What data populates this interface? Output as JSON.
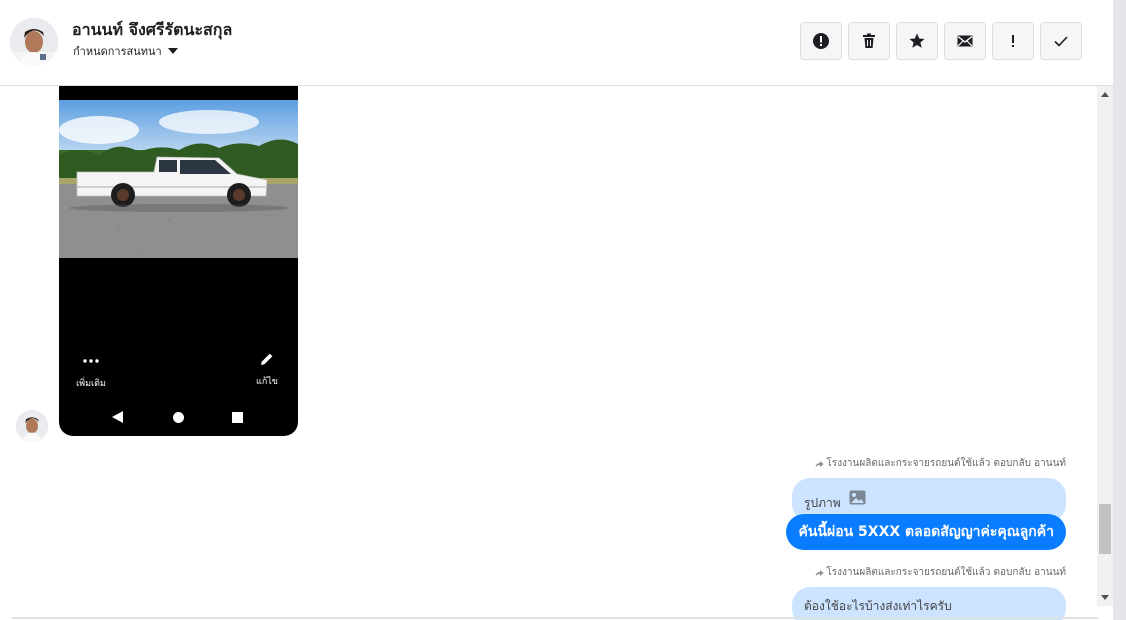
{
  "header": {
    "contact_name": "อานนท์ จึงศรีรัตนะสกุล",
    "assign_label": "กำหนดการสนทนา",
    "actions": [
      {
        "name": "mark-spam-button",
        "icon": "alert-circle-icon"
      },
      {
        "name": "delete-button",
        "icon": "trash-icon"
      },
      {
        "name": "star-button",
        "icon": "star-icon"
      },
      {
        "name": "mark-unread-button",
        "icon": "envelope-icon"
      },
      {
        "name": "mark-important-button",
        "icon": "exclamation-icon"
      },
      {
        "name": "mark-done-button",
        "icon": "check-icon"
      }
    ]
  },
  "phone_screenshot": {
    "more_label": "เพิ่มเติม",
    "edit_label": "แก้ไข"
  },
  "messages": [
    {
      "reply_meta": "โรงงานผลิตและกระจายรถยนต์ใช้แล้ว ตอบกลับ อานนท์",
      "quoted": "รูปภาพ",
      "text": "คันนี้ผ่อน 5XXX ตลอดสัญญาค่ะคุณลูกค้า"
    },
    {
      "reply_meta": "โรงงานผลิตและกระจายรถยนต์ใช้แล้ว ตอบกลับ อานนท์",
      "quoted": "ต้องใช้อะไรบ้างส่งเท่าไรครับ"
    }
  ],
  "colors": {
    "accent": "#0a7cff",
    "quote_bubble": "#cce4ff"
  }
}
